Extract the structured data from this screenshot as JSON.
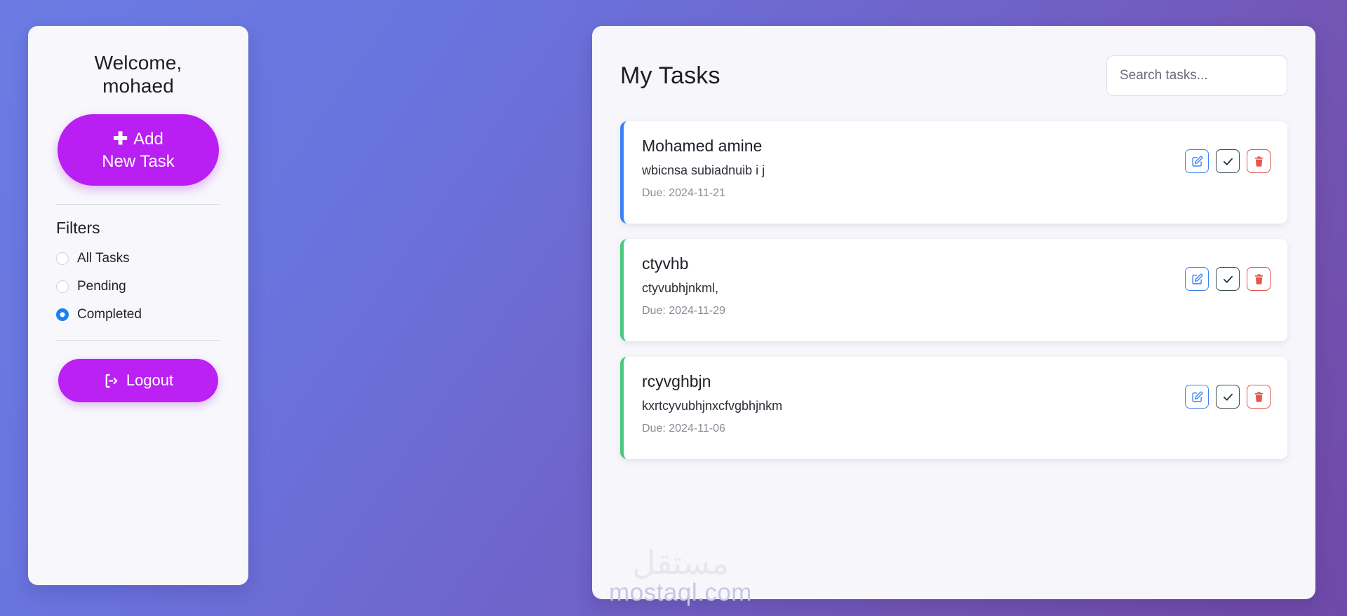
{
  "theme": {
    "bg_gradient_from": "#6a7ce3",
    "bg_gradient_to": "#7049a8",
    "panel_bg": "#f7f7fb",
    "accent_purple": "#b91ef2",
    "accent_blue": "#3b82f6",
    "accent_green": "#4ac97e",
    "accent_red": "#e4564e",
    "radio_selected": "#1a82f0"
  },
  "sidebar": {
    "welcome_line1": "Welcome,",
    "welcome_line2": "mohaed",
    "add_task": {
      "plus_icon": "plus-icon",
      "label_line1": "Add",
      "label_line2": "New Task"
    },
    "filters_title": "Filters",
    "filters": [
      {
        "label": "All Tasks",
        "selected": false
      },
      {
        "label": "Pending",
        "selected": false
      },
      {
        "label": "Completed",
        "selected": true
      }
    ],
    "logout": {
      "icon": "sign-out-icon",
      "label": "Logout"
    }
  },
  "main": {
    "title": "My Tasks",
    "search": {
      "placeholder": "Search tasks...",
      "value": ""
    },
    "actions": {
      "edit_icon": "edit-pencil-square-icon",
      "complete_icon": "check-icon",
      "delete_icon": "trash-icon"
    },
    "tasks": [
      {
        "title": "Mohamed amine",
        "description": "wbicnsa subiadnuib i j",
        "due": "Due: 2024-11-21",
        "status": "pending",
        "accent": "#3b82f6"
      },
      {
        "title": "ctyvhb",
        "description": "ctyvubhjnkml,",
        "due": "Due: 2024-11-29",
        "status": "completed",
        "accent": "#4ac97e"
      },
      {
        "title": "rcyvghbjn",
        "description": "kxrtcyvubhjnxcfvgbhjnkm",
        "due": "Due: 2024-11-06",
        "status": "completed",
        "accent": "#4ac97e"
      }
    ]
  },
  "watermark": {
    "arabic": "مستقل",
    "latin": "mostaql.com"
  }
}
